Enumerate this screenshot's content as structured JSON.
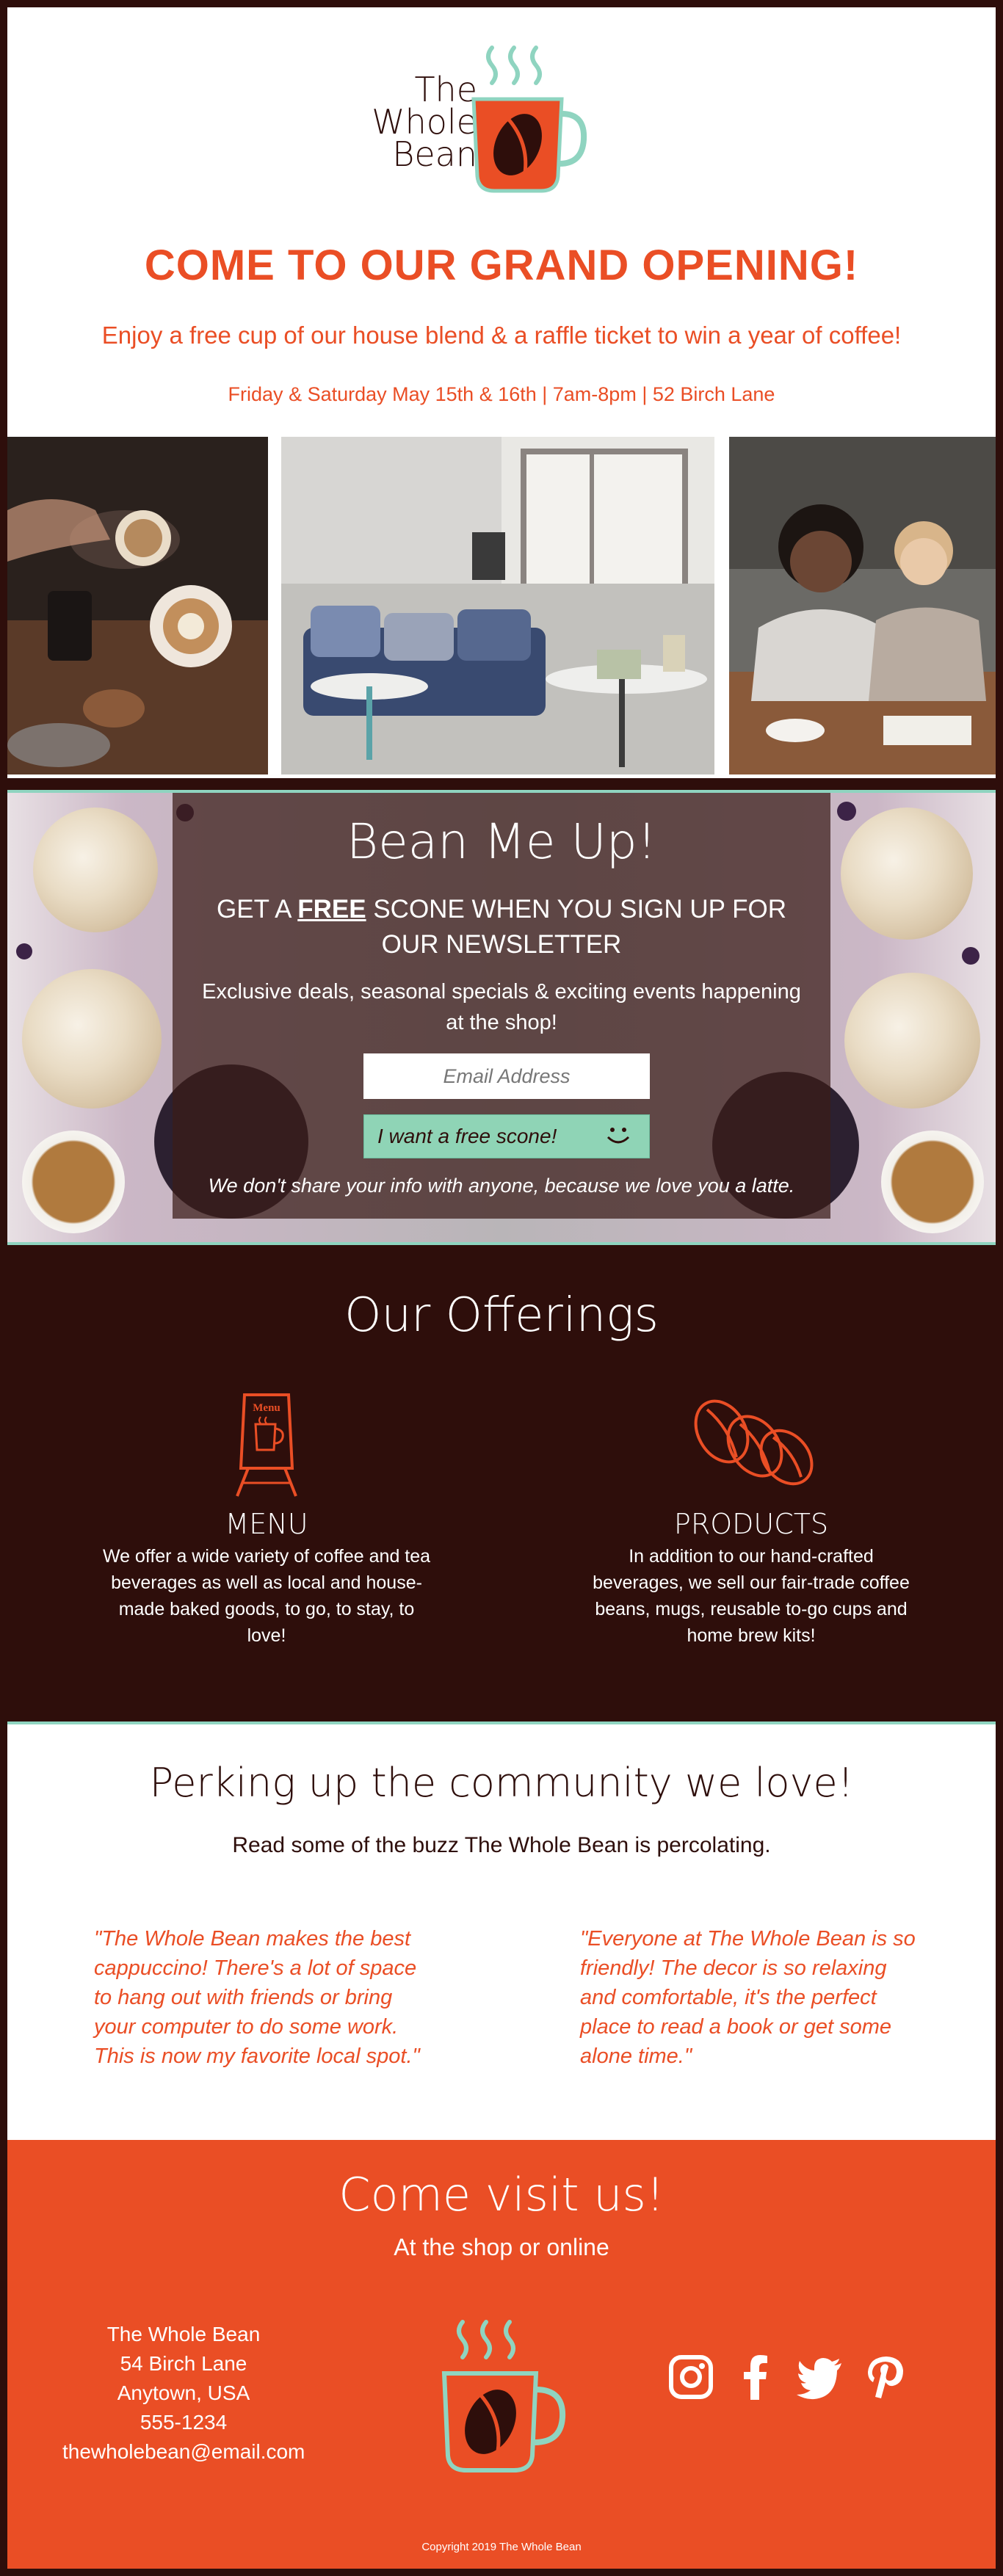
{
  "brand": {
    "line1": "The",
    "line2": "Whole",
    "line3": "Bean",
    "colors": {
      "orange": "#ea4e25",
      "brown": "#2e0e0b",
      "mint": "#8fd4c0"
    }
  },
  "hero": {
    "title": "COME TO OUR GRAND OPENING!",
    "subtitle": "Enjoy a free cup of our house blend & a raffle ticket to win a year of coffee!",
    "details": "Friday & Saturday May 15th & 16th | 7am-8pm | 52 Birch Lane"
  },
  "newsletter": {
    "title": "Bean Me Up!",
    "head_pre": "GET A ",
    "head_free": "FREE",
    "head_post": " SCONE WHEN YOU SIGN UP FOR OUR NEWSLETTER",
    "sub": "Exclusive deals, seasonal specials & exciting events happening at the shop!",
    "email_placeholder": "Email Address",
    "button_label": "I want a free scone!",
    "note": "We don't share your info with anyone, because we love you a latte."
  },
  "offerings": {
    "title": "Our Offerings",
    "menu_icon_text": "Menu",
    "items": [
      {
        "name": "MENU",
        "text": "We offer a wide variety of coffee and tea beverages as well as local and house-made baked goods, to go, to stay, to love!",
        "icon": "menu-board-icon"
      },
      {
        "name": "PRODUCTS",
        "text": "In addition to our hand-crafted beverages, we sell our fair-trade coffee beans, mugs, reusable to-go cups and home brew kits!",
        "icon": "coffee-beans-icon"
      }
    ]
  },
  "community": {
    "title": "Perking up the community we love!",
    "subtitle": "Read some of the buzz The Whole Bean is percolating.",
    "quotes": [
      "\"The Whole Bean makes the best cappuccino! There's a lot of space to hang out with friends or bring your computer to do some work. This is now my favorite local spot.\"",
      "\"Everyone at The Whole Bean is so friendly! The decor is so relaxing and comfortable, it's the perfect place to read a book or get some alone time.\""
    ]
  },
  "footer": {
    "title": "Come visit us!",
    "subtitle": "At the shop or online",
    "address": [
      "The Whole Bean",
      "54 Birch Lane",
      "Anytown, USA",
      "555-1234",
      "thewholebean@email.com"
    ],
    "social": [
      "instagram-icon",
      "facebook-icon",
      "twitter-icon",
      "pinterest-icon"
    ],
    "copyright": "Copyright 2019 The Whole Bean"
  }
}
